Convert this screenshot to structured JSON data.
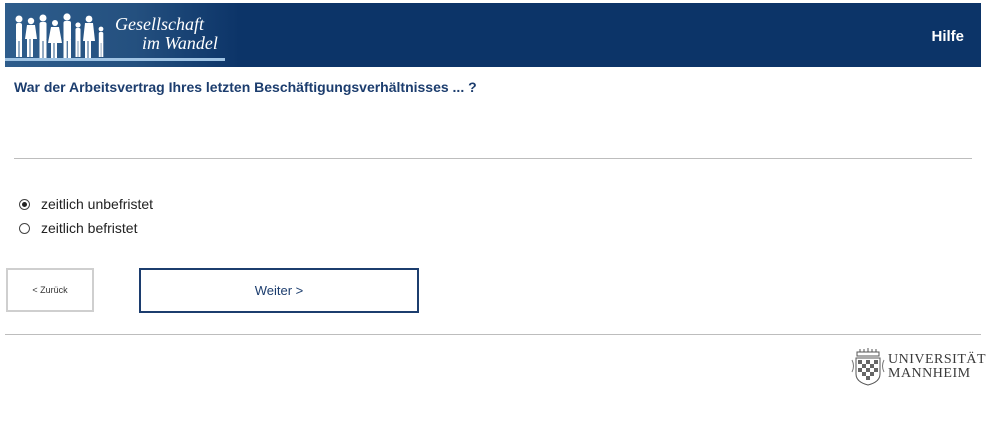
{
  "header": {
    "brand_line1": "Gesellschaft",
    "brand_line2": "im Wandel",
    "help_label": "Hilfe"
  },
  "question": {
    "text": "War der Arbeitsvertrag Ihres letzten Beschäftigungsverhältnisses ... ?"
  },
  "options": [
    {
      "label": "zeitlich unbefristet",
      "selected": true
    },
    {
      "label": "zeitlich befristet",
      "selected": false
    }
  ],
  "navigation": {
    "back_label": "< Zurück",
    "next_label": "Weiter >"
  },
  "footer": {
    "university_line1": "UNIVERSITÄT",
    "university_line2": "MANNHEIM"
  },
  "colors": {
    "header_bg": "#0c3468",
    "accent": "#1c3d6e"
  }
}
